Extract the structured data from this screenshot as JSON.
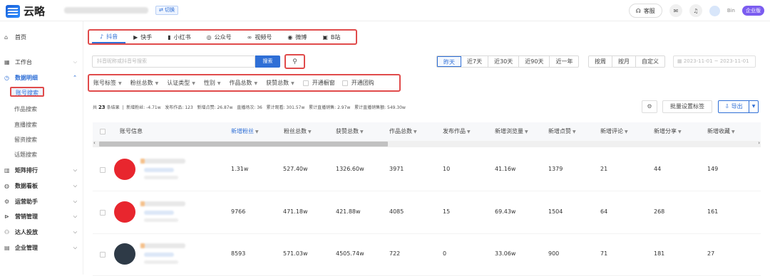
{
  "app": {
    "brand": "云略",
    "switch_label": "⇄ 切换",
    "kefu_label": "客服",
    "user_name": "Bin",
    "enterprise_label": "企业版"
  },
  "sidebar": {
    "items": [
      {
        "label": "首页",
        "icon": "home-icon",
        "glyph": "⌂"
      },
      {
        "label": "工作台",
        "icon": "grid-icon",
        "glyph": "▦"
      },
      {
        "label": "数据明细",
        "icon": "data-icon",
        "glyph": "◷"
      },
      {
        "label": "矩阵排行",
        "icon": "rank-icon",
        "glyph": "▥"
      },
      {
        "label": "数据看板",
        "icon": "dashboard-icon",
        "glyph": "◍"
      },
      {
        "label": "运营助手",
        "icon": "assistant-icon",
        "glyph": "⚙"
      },
      {
        "label": "营销管理",
        "icon": "marketing-icon",
        "glyph": "⊳"
      },
      {
        "label": "达人投放",
        "icon": "influencer-icon",
        "glyph": "⚇"
      },
      {
        "label": "企业管理",
        "icon": "company-icon",
        "glyph": "▤"
      }
    ],
    "subitems": [
      "账号搜索",
      "作品搜索",
      "直播搜索",
      "留资搜索",
      "话题搜索"
    ]
  },
  "platforms": [
    {
      "label": "抖音",
      "glyph": "♪"
    },
    {
      "label": "快手",
      "glyph": "▶"
    },
    {
      "label": "小红书",
      "glyph": "▮"
    },
    {
      "label": "公众号",
      "glyph": "◎"
    },
    {
      "label": "视频号",
      "glyph": "∞"
    },
    {
      "label": "微博",
      "glyph": "◉"
    },
    {
      "label": "B站",
      "glyph": "▣"
    }
  ],
  "search": {
    "placeholder": "抖音昵称或抖音号搜索",
    "button": "搜索"
  },
  "date_quick": [
    "昨天",
    "近7天",
    "近30天",
    "近90天",
    "近一年"
  ],
  "date_mode": [
    "按周",
    "按月",
    "自定义"
  ],
  "date_range": "2023-11-01 ~ 2023-11-01",
  "filters": {
    "dropdowns": [
      "账号标签",
      "粉丝总数",
      "认证类型",
      "性别",
      "作品总数",
      "获赞总数"
    ],
    "checkboxes": [
      "开通橱窗",
      "开通团购"
    ]
  },
  "stats": {
    "prefix": "共",
    "count": "23",
    "suffix": "条结果",
    "items": [
      "新增粉丝: -4.71w",
      "发布作品: 123",
      "新增点赞: 26.87w",
      "直播场次: 36",
      "累计观看: 301.57w",
      "累计直播销售: 2.97w",
      "累计直播销售额: 549.30w"
    ]
  },
  "toolbar": {
    "batch_label": "批量设置标签",
    "export_label": "⇩ 导出"
  },
  "table": {
    "columns": [
      "账号信息",
      "新增粉丝",
      "粉丝总数",
      "获赞总数",
      "作品总数",
      "发布作品",
      "新增浏览量",
      "新增点赞",
      "新增评论",
      "新增分享",
      "新增收藏"
    ],
    "rows": [
      {
        "avatar_color": "#e8262e",
        "cells": [
          "1.31w",
          "527.40w",
          "1326.60w",
          "3971",
          "10",
          "41.16w",
          "1379",
          "21",
          "44",
          "149"
        ]
      },
      {
        "avatar_color": "#e8262e",
        "cells": [
          "9766",
          "471.18w",
          "421.88w",
          "4085",
          "15",
          "69.43w",
          "1504",
          "64",
          "268",
          "161"
        ]
      },
      {
        "avatar_color": "#2e3a47",
        "cells": [
          "8593",
          "571.03w",
          "4505.74w",
          "722",
          "0",
          "33.06w",
          "900",
          "71",
          "181",
          "27"
        ]
      }
    ]
  },
  "colors": {
    "accent": "#2f6fd6",
    "highlight": "#e04b4b",
    "enterprise": "#7b5cf0"
  }
}
